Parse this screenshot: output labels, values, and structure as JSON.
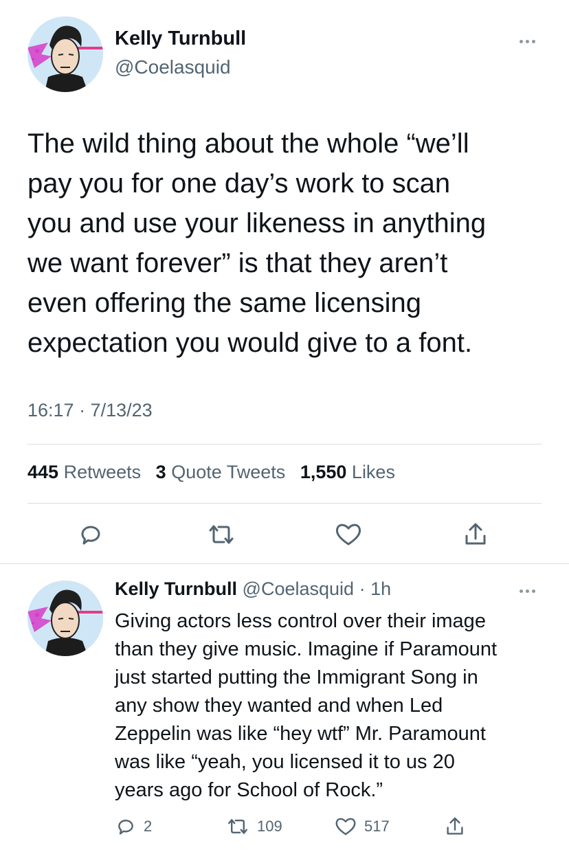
{
  "main_tweet": {
    "author": {
      "display_name": "Kelly Turnbull",
      "handle": "@Coelasquid"
    },
    "text": "The wild thing about the whole “we’ll\npay you for one day’s work to scan\nyou and use your likeness in anything\nwe want forever” is that they aren’t\neven offering the same licensing\nexpectation you would give to a font.",
    "timestamp": "16:17 · 7/13/23",
    "stats": {
      "retweets_count": "445",
      "retweets_label": "Retweets",
      "quote_tweets_count": "3",
      "quote_tweets_label": "Quote Tweets",
      "likes_count": "1,550",
      "likes_label": "Likes"
    },
    "actions": [
      "reply-icon",
      "retweet-icon",
      "like-icon",
      "share-icon"
    ]
  },
  "reply_tweet": {
    "author": {
      "display_name": "Kelly Turnbull",
      "handle": "@Coelasquid",
      "separator": "·",
      "time_ago": "1h"
    },
    "text": "Giving actors less control over their image\nthan they give music. Imagine if Paramount\njust started putting the Immigrant Song in\nany show they wanted and when Led\nZeppelin was like “hey wtf” Mr. Paramount\nwas like “yeah, you licensed it to us 20\nyears ago for School of Rock.”",
    "actions": {
      "reply_count": "2",
      "retweet_count": "109",
      "like_count": "517"
    }
  },
  "colors": {
    "text_primary": "#0f1419",
    "text_secondary": "#536471",
    "divider": "#d9dde1",
    "avatar_bg": "#cfe6f7",
    "avatar_accent": "#d63cc8"
  }
}
